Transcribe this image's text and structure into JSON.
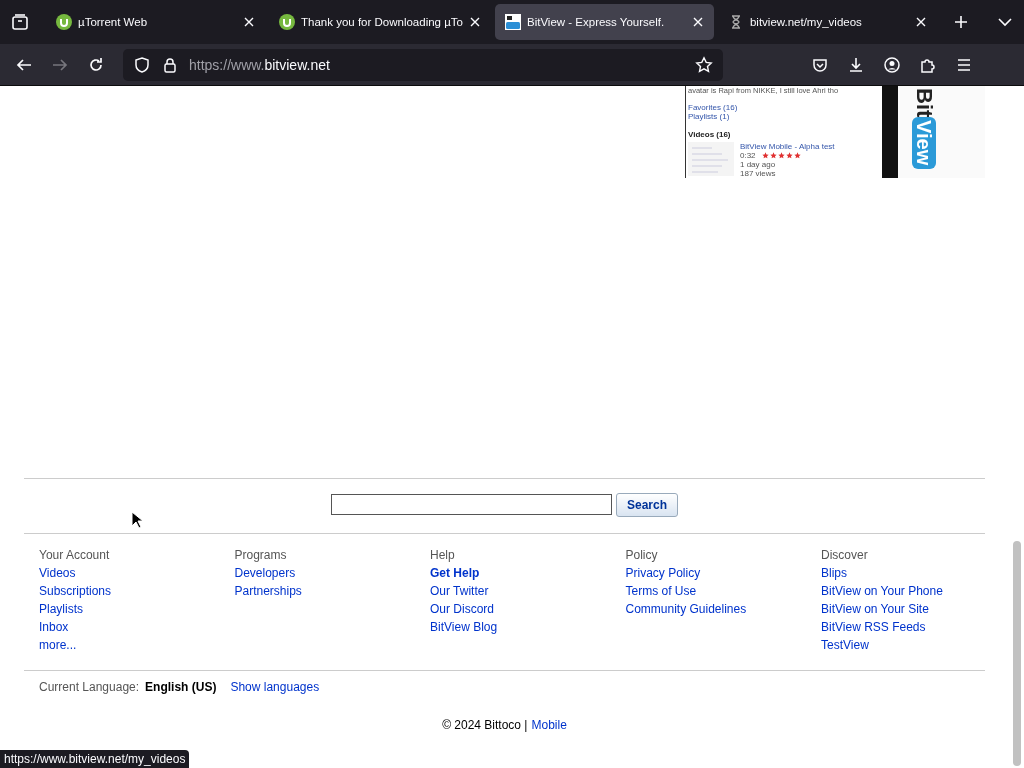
{
  "tabs": [
    {
      "title": "µTorrent Web",
      "kind": "torrent",
      "selected": false
    },
    {
      "title": "Thank you for Downloading µTo",
      "kind": "torrent",
      "selected": false
    },
    {
      "title": "BitView - Express Yourself.",
      "kind": "site",
      "selected": true
    },
    {
      "title": "bitview.net/my_videos",
      "kind": "loading",
      "selected": false
    }
  ],
  "address_bar": {
    "url_prefix": "https://www.",
    "url_host": "bitview.net"
  },
  "embedded_screenshot": {
    "bio": "avatar is Rapi from NIKKE, I still love Ahri tho",
    "links": [
      "Favorites (16)",
      "Playlists (1)"
    ],
    "videos_heading": "Videos (16)",
    "video": {
      "title": "BitView Mobile - Alpha test",
      "duration": "0:32",
      "stars": 5,
      "age": "1 day ago",
      "views": "187 views"
    },
    "logo": [
      "Bit",
      "View"
    ]
  },
  "search": {
    "button": "Search"
  },
  "footer_columns": [
    {
      "heading": "Your Account",
      "links": [
        {
          "label": "Videos",
          "bold": false
        },
        {
          "label": "Subscriptions",
          "bold": false
        },
        {
          "label": "Playlists",
          "bold": false
        },
        {
          "label": "Inbox",
          "bold": false
        },
        {
          "label": "more...",
          "bold": false
        }
      ]
    },
    {
      "heading": "Programs",
      "links": [
        {
          "label": "Developers",
          "bold": false
        },
        {
          "label": "Partnerships",
          "bold": false
        }
      ]
    },
    {
      "heading": "Help",
      "links": [
        {
          "label": "Get Help",
          "bold": true
        },
        {
          "label": "Our Twitter",
          "bold": false
        },
        {
          "label": "Our Discord",
          "bold": false
        },
        {
          "label": "BitView Blog",
          "bold": false
        }
      ]
    },
    {
      "heading": "Policy",
      "links": [
        {
          "label": "Privacy Policy",
          "bold": false
        },
        {
          "label": "Terms of Use",
          "bold": false
        },
        {
          "label": "Community Guidelines",
          "bold": false
        }
      ]
    },
    {
      "heading": "Discover",
      "links": [
        {
          "label": "Blips",
          "bold": false
        },
        {
          "label": "BitView on Your Phone",
          "bold": false
        },
        {
          "label": "BitView on Your Site",
          "bold": false
        },
        {
          "label": "BitView RSS Feeds",
          "bold": false
        },
        {
          "label": "TestView",
          "bold": false
        }
      ]
    }
  ],
  "language": {
    "label": "Current Language:",
    "value": "English (US)",
    "link": "Show languages"
  },
  "copyright": {
    "text": "© 2024 Bittoco |",
    "link": "Mobile"
  },
  "status_url": "https://www.bitview.net/my_videos"
}
